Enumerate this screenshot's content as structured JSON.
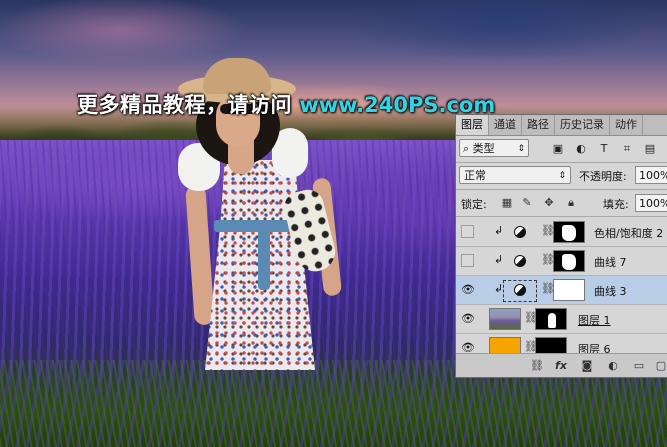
{
  "watermark": {
    "chinese": "更多精品教程，请访问",
    "url": "www.240PS.com",
    "url_color": "#31d4e6"
  },
  "panel": {
    "tabs": [
      {
        "label": "图层",
        "active": true
      },
      {
        "label": "通道",
        "active": false
      },
      {
        "label": "路径",
        "active": false
      },
      {
        "label": "历史记录",
        "active": false
      },
      {
        "label": "动作",
        "active": false
      }
    ],
    "filter": {
      "search_icon": "search-icon",
      "kind_label": "类型",
      "icons": [
        "image-filter-icon",
        "adjustment-filter-icon",
        "type-filter-icon",
        "shape-filter-icon",
        "smart-object-filter-icon"
      ]
    },
    "blend": {
      "mode": "正常",
      "opacity_label": "不透明度:",
      "opacity_value": "100%"
    },
    "lock": {
      "label": "锁定:",
      "icons": [
        "lock-transparent-icon",
        "lock-paint-icon",
        "lock-move-icon",
        "lock-all-icon"
      ],
      "fill_label": "填充:",
      "fill_value": "100%"
    },
    "layers": [
      {
        "name": "色相/饱和度 2",
        "visible": false,
        "clipped": true,
        "type": "adjustment",
        "selected": false
      },
      {
        "name": "曲线 7",
        "visible": false,
        "clipped": true,
        "type": "adjustment",
        "selected": false
      },
      {
        "name": "曲线 3",
        "visible": true,
        "clipped": true,
        "type": "adjustment",
        "selected": true
      },
      {
        "name": "图层 1",
        "visible": true,
        "clipped": false,
        "type": "pixel",
        "selected": false
      },
      {
        "name": "图层 6",
        "visible": true,
        "clipped": false,
        "type": "pixel",
        "selected": false
      }
    ],
    "footer_icons": [
      "link-icon",
      "fx-icon",
      "add-mask-icon",
      "new-adjustment-icon",
      "new-group-icon",
      "new-layer-icon"
    ],
    "fx_label": "fx"
  },
  "colors": {
    "panel_bg": "#d6d6d6",
    "selected_row": "#b9cde6",
    "layer6_fill": "#f5a400"
  }
}
